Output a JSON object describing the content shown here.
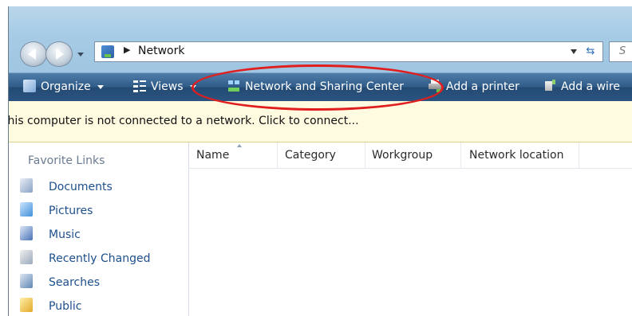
{
  "address_bar": {
    "location": "Network",
    "search_placeholder": "S"
  },
  "toolbar": {
    "organize_label": "Organize",
    "views_label": "Views",
    "network_sharing_label": "Network and Sharing Center",
    "add_printer_label": "Add a printer",
    "add_wireless_label": "Add a wire"
  },
  "infobar": {
    "message": "This computer is not connected to a network. Click to connect..."
  },
  "navpane": {
    "heading": "Favorite Links",
    "items": [
      {
        "label": "Documents",
        "icon": "documents-icon"
      },
      {
        "label": "Pictures",
        "icon": "pictures-icon"
      },
      {
        "label": "Music",
        "icon": "music-icon"
      },
      {
        "label": "Recently Changed",
        "icon": "recently-changed-icon"
      },
      {
        "label": "Searches",
        "icon": "searches-icon"
      },
      {
        "label": "Public",
        "icon": "public-folder-icon"
      }
    ]
  },
  "content": {
    "columns": [
      "Name",
      "Category",
      "Workgroup",
      "Network location"
    ]
  },
  "colors": {
    "toolbar": "#2f5b88",
    "infobar": "#fffbe0",
    "highlight": "#e01e1e",
    "link": "#1d4f8c"
  }
}
